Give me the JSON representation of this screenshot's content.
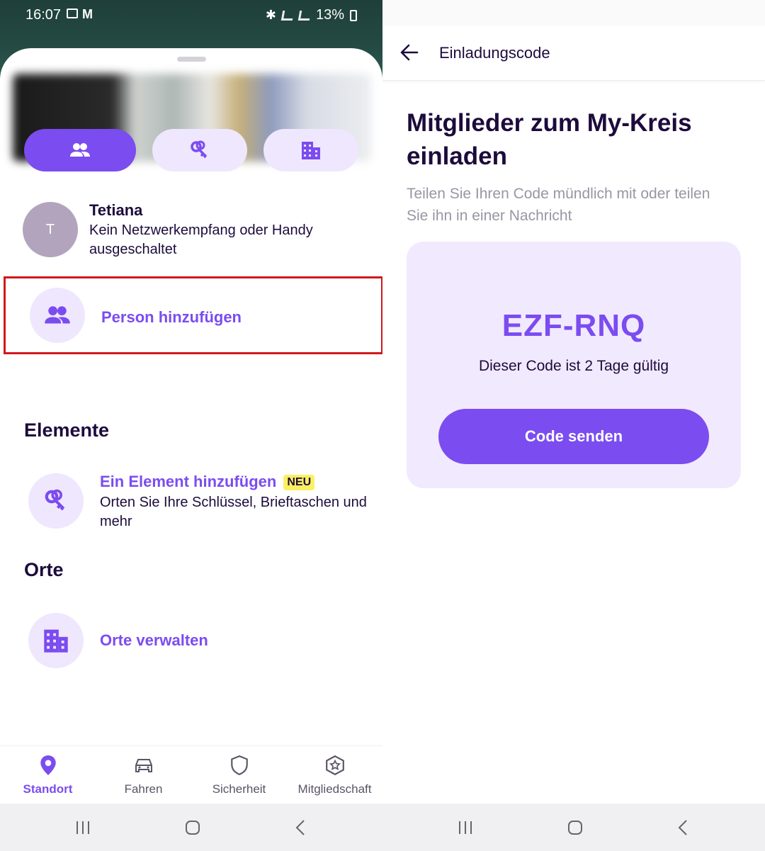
{
  "left": {
    "status_bar": {
      "time": "16:07",
      "battery": "13%"
    },
    "filter_pills": [
      {
        "icon": "people-icon",
        "active": true
      },
      {
        "icon": "keys-icon",
        "active": false
      },
      {
        "icon": "building-icon",
        "active": false
      }
    ],
    "member": {
      "initial": "T",
      "name": "Tetiana",
      "status": "Kein Netzwerkempfang oder Handy ausgeschaltet"
    },
    "add_person": {
      "label": "Person hinzufügen"
    },
    "elements_section": {
      "heading": "Elemente",
      "add_item_title": "Ein Element hinzufügen",
      "new_badge": "NEU",
      "add_item_desc": "Orten Sie Ihre Schlüssel, Brieftaschen und mehr"
    },
    "places_section": {
      "heading": "Orte",
      "manage_label": "Orte verwalten"
    },
    "tabs": [
      {
        "label": "Standort",
        "icon": "location-pin-icon",
        "active": true
      },
      {
        "label": "Fahren",
        "icon": "car-icon",
        "active": false
      },
      {
        "label": "Sicherheit",
        "icon": "shield-icon",
        "active": false
      },
      {
        "label": "Mitgliedschaft",
        "icon": "star-badge-icon",
        "active": false
      }
    ]
  },
  "right": {
    "app_bar": {
      "title": "Einladungscode"
    },
    "title": "Mitglieder zum My-Kreis einladen",
    "subtitle": "Teilen Sie Ihren Code mündlich mit oder teilen Sie ihn in einer Nachricht",
    "code_card": {
      "code": "EZF-RNQ",
      "validity": "Dieser Code ist 2 Tage gültig",
      "send_label": "Code senden"
    }
  },
  "colors": {
    "accent": "#7b4cf0",
    "accent_light": "#efe7fd",
    "text_dark": "#1d0b3c",
    "highlight_box": "#d0191c",
    "badge_yellow": "#fbf063"
  }
}
